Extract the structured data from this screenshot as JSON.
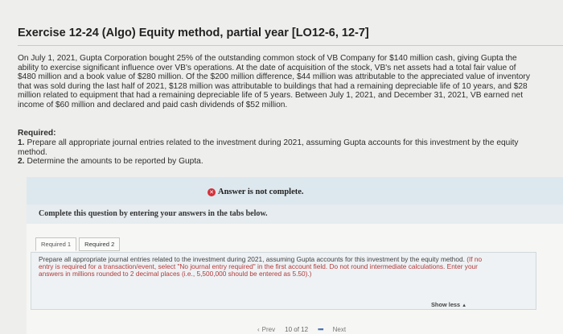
{
  "exercise": {
    "title": "Exercise 12-24 (Algo) Equity method, partial year [LO12-6, 12-7]",
    "problem": "On July 1, 2021, Gupta Corporation bought 25% of the outstanding common stock of VB Company for $140 million cash, giving Gupta the ability to exercise significant influence over VB's operations. At the date of acquisition of the stock, VB's net assets had a total fair value of $480 million and a book value of $280 million. Of the $200 million difference, $44 million was attributable to the appreciated value of inventory that was sold during the last half of 2021, $128 million was attributable to buildings that had a remaining depreciable life of 10 years, and $28 million related to equipment that had a remaining depreciable life of 5 years. Between July 1, 2021, and December 31, 2021, VB earned net income of $60 million and declared and paid cash dividends of $52 million."
  },
  "required": {
    "heading": "Required:",
    "items": [
      {
        "num": "1.",
        "text": "Prepare all appropriate journal entries related to the investment during 2021, assuming Gupta accounts for this investment by the equity method."
      },
      {
        "num": "2.",
        "text": "Determine the amounts to be reported by Gupta."
      }
    ]
  },
  "answer_panel": {
    "status": "Answer is not complete.",
    "complete_prompt": "Complete this question by entering your answers in the tabs below.",
    "tabs": [
      {
        "label": "Required 1"
      },
      {
        "label": "Required 2"
      }
    ],
    "instructions_main": "Prepare all appropriate journal entries related to the investment during 2021, assuming Gupta accounts for this investment by the equity method. ",
    "instructions_red": "(If no entry is required for a transaction/event, select \"No journal entry required\" in the first account field. Do not round intermediate calculations. Enter your answers in millions rounded to 2 decimal places (i.e., 5,500,000 should be entered as 5.50).)",
    "show_less": "Show less"
  },
  "pager": {
    "prev": "Prev",
    "position": "10 of 12",
    "next": "Next"
  }
}
